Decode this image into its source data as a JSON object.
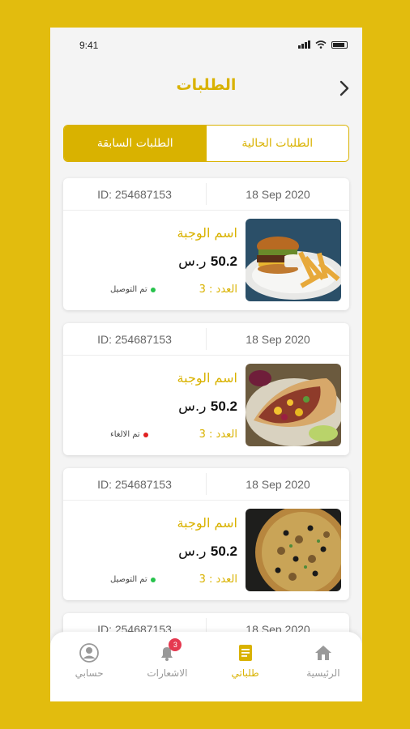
{
  "status_bar": {
    "time": "9:41"
  },
  "header": {
    "title": "الطلبات"
  },
  "tabs": [
    {
      "label": "الطلبات الحالية",
      "active": false
    },
    {
      "label": "الطلبات السابقة",
      "active": true
    }
  ],
  "orders": [
    {
      "id": "ID: 254687153",
      "date": "18 Sep 2020",
      "meal_name": "اسم الوجبة",
      "price": "50.2",
      "currency": "ر.س",
      "quantity_label": "العدد : 3",
      "status": "تم التوصيل",
      "status_color": "#27C24C",
      "image": "burger-image"
    },
    {
      "id": "ID: 254687153",
      "date": "18 Sep 2020",
      "meal_name": "اسم الوجبة",
      "price": "50.2",
      "currency": "ر.س",
      "quantity_label": "العدد : 3",
      "status": "تم الالغاء",
      "status_color": "#E02020",
      "image": "wrap-image"
    },
    {
      "id": "ID: 254687153",
      "date": "18 Sep 2020",
      "meal_name": "اسم الوجبة",
      "price": "50.2",
      "currency": "ر.س",
      "quantity_label": "العدد : 3",
      "status": "تم التوصيل",
      "status_color": "#27C24C",
      "image": "pizza-image"
    },
    {
      "id": "ID: 254687153",
      "date": "18 Sep 2020"
    }
  ],
  "tabbar": {
    "items": [
      {
        "label": "الرئيسية",
        "icon": "home-icon",
        "active": false
      },
      {
        "label": "طلباتي",
        "icon": "orders-icon",
        "active": true
      },
      {
        "label": "الاشعارات",
        "icon": "bell-icon",
        "active": false,
        "badge": "3"
      },
      {
        "label": "حسابي",
        "icon": "user-icon",
        "active": false
      }
    ]
  },
  "colors": {
    "accent": "#D9B200",
    "background": "#E2BC0E",
    "badge": "#E53950"
  }
}
